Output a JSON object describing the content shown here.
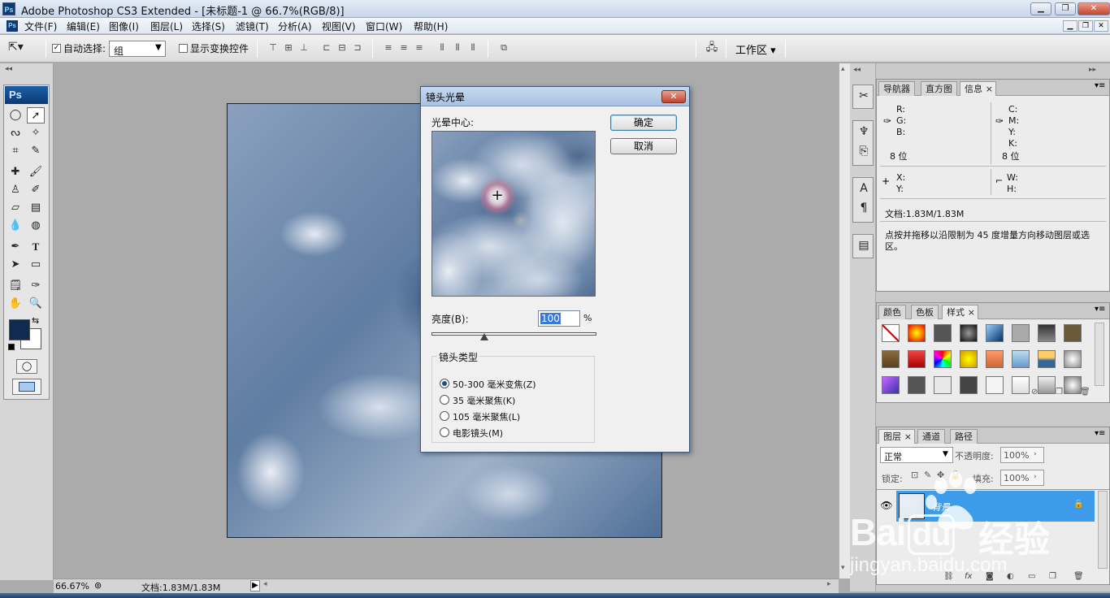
{
  "window": {
    "title": "Adobe Photoshop CS3 Extended - [未标题-1 @ 66.7%(RGB/8)]",
    "app_badge": "Ps"
  },
  "menu": {
    "items": [
      "文件(F)",
      "编辑(E)",
      "图像(I)",
      "图层(L)",
      "选择(S)",
      "滤镜(T)",
      "分析(A)",
      "视图(V)",
      "窗口(W)",
      "帮助(H)"
    ]
  },
  "options": {
    "auto_select_label": "自动选择:",
    "auto_select_value": "组",
    "show_transform_label": "显示变换控件",
    "workspace_label": "工作区"
  },
  "toolbox": {
    "badge": "Ps"
  },
  "status": {
    "zoom": "66.67%",
    "doc_info": "文档:1.83M/1.83M"
  },
  "info_panel": {
    "tabs": [
      "导航器",
      "直方图",
      "信息"
    ],
    "rgb_labels": [
      "R:",
      "G:",
      "B:"
    ],
    "cmyk_labels": [
      "C:",
      "M:",
      "Y:",
      "K:"
    ],
    "bit_left": "8 位",
    "bit_right": "8 位",
    "x_label": "X:",
    "y_label": "Y:",
    "w_label": "W:",
    "h_label": "H:",
    "doc_size": "文档:1.83M/1.83M",
    "hint": "点按并拖移以沿限制为 45 度增量方向移动图层或选区。"
  },
  "styles_panel": {
    "tabs": [
      "颜色",
      "色板",
      "样式"
    ]
  },
  "layers_panel": {
    "tabs": [
      "图层",
      "通道",
      "路径"
    ],
    "blend_mode": "正常",
    "opacity_label": "不透明度:",
    "opacity_value": "100%",
    "lock_label": "锁定:",
    "fill_label": "填充:",
    "fill_value": "100%",
    "layer_name": "背景"
  },
  "dialog": {
    "title": "镜头光晕",
    "center_label": "光晕中心:",
    "ok": "确定",
    "cancel": "取消",
    "brightness_label": "亮度(B):",
    "brightness_value": "100",
    "brightness_unit": "%",
    "brightness_fraction": 0.32,
    "lens_type_label": "镜头类型",
    "lens_options": [
      "50-300 毫米变焦(Z)",
      "35 毫米聚焦(K)",
      "105 毫米聚焦(L)",
      "电影镜头(M)"
    ],
    "selected_lens": 0
  },
  "watermark": {
    "logo": "Bai",
    "logo_tail": "du",
    "cn": "经验",
    "url": "jingyan.baidu.com"
  },
  "colors": {
    "foreground": "#0f2c4f",
    "background": "#ffffff",
    "layer_selected": "#3d9be9",
    "accent": "#1f4d8c"
  }
}
